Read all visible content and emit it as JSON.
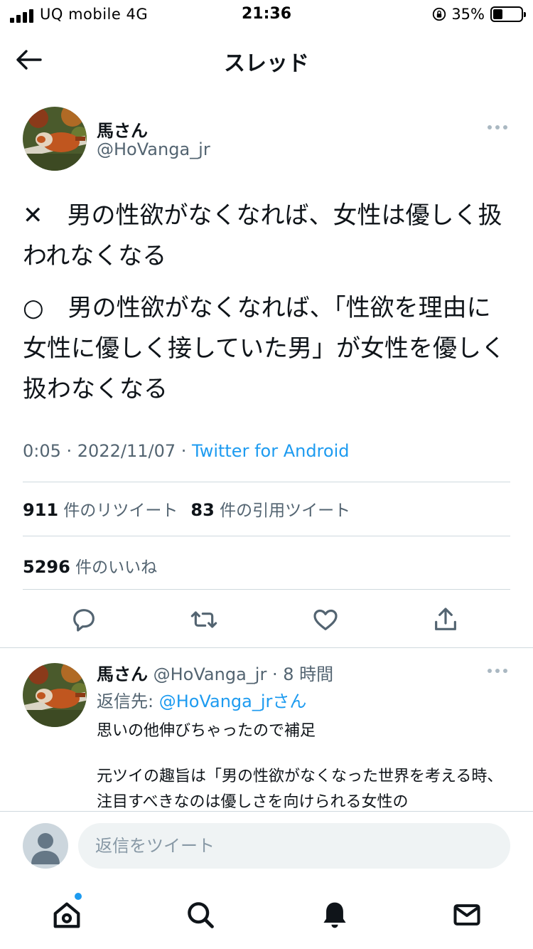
{
  "status_bar": {
    "carrier": "UQ mobile  4G",
    "time": "21:36",
    "battery": "35%",
    "battery_level": 0.35
  },
  "header": {
    "title": "スレッド",
    "back_icon": "arrow-left-icon"
  },
  "main_tweet": {
    "name": "馬さん",
    "handle": "@HoVanga_jr",
    "text_lines": [
      "✕　男の性欲がなくなれば、女性は優しく扱われなくなる",
      "○　男の性欲がなくなれば、「性欲を理由に女性に優しく接していた男」が女性を優しく扱わなくなる"
    ],
    "time_date": "0:05 · 2022/11/07 · ",
    "source": "Twitter for Android",
    "retweets_count": "911",
    "retweets_label": "件のリツイート",
    "quotes_count": "83",
    "quotes_label": "件の引用ツイート",
    "likes_count": "5296",
    "likes_label": "件のいいね",
    "action_icons": [
      "reply-icon",
      "retweet-icon",
      "like-icon",
      "share-icon"
    ]
  },
  "reply_tweet": {
    "name": "馬さん",
    "handle_time": " @HoVanga_jr · 8 時間",
    "reply_to_prefix": "返信先: ",
    "reply_to_link": "@HoVanga_jr",
    "reply_to_suffix": "さん",
    "body_line1": "思いの他伸びちゃったので補足",
    "body_line2": "元ツイの趣旨は「男の性欲がなくなった世界を考える時、注目すべきなのは優しさを向けられる女性の"
  },
  "compose": {
    "placeholder": "返信をツイート"
  },
  "tabbar": {
    "icons": [
      "home-icon",
      "search-icon",
      "notifications-icon",
      "messages-icon"
    ]
  },
  "colors": {
    "accent": "#1d9bf0",
    "secondary_text": "#536471",
    "divider": "#cfd9de"
  }
}
